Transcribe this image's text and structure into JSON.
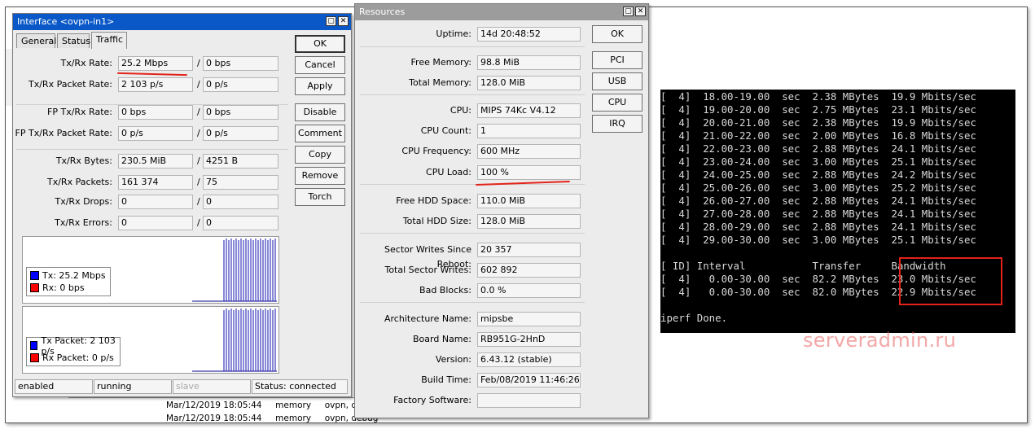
{
  "interface_window": {
    "title": "Interface <ovpn-in1>",
    "tabs": [
      "General",
      "Status",
      "Traffic"
    ],
    "active_tab": "Traffic",
    "rows": [
      {
        "label": "Tx/Rx Rate:",
        "tx": "25.2 Mbps",
        "rx": "0 bps"
      },
      {
        "label": "Tx/Rx Packet Rate:",
        "tx": "2 103 p/s",
        "rx": "0 p/s"
      },
      {
        "label": "FP Tx/Rx Rate:",
        "tx": "0 bps",
        "rx": "0 bps"
      },
      {
        "label": "FP Tx/Rx Packet Rate:",
        "tx": "0 p/s",
        "rx": "0 p/s"
      },
      {
        "label": "Tx/Rx Bytes:",
        "tx": "230.5 MiB",
        "rx": "4251 B"
      },
      {
        "label": "Tx/Rx Packets:",
        "tx": "161 374",
        "rx": "75"
      },
      {
        "label": "Tx/Rx Drops:",
        "tx": "0",
        "rx": "0"
      },
      {
        "label": "Tx/Rx Errors:",
        "tx": "0",
        "rx": "0"
      }
    ],
    "slash": "/",
    "buttons": [
      "OK",
      "Cancel",
      "Apply",
      "Disable",
      "Comment",
      "Copy",
      "Remove",
      "Torch"
    ],
    "graph1_legend": [
      {
        "text": "Tx:  25.2 Mbps",
        "color": "#0000ff"
      },
      {
        "text": "Rx:  0 bps",
        "color": "#ff0000"
      }
    ],
    "graph2_legend": [
      {
        "text": "Tx Packet:  2 103 p/s",
        "color": "#0000ff"
      },
      {
        "text": "Rx Packet:  0 p/s",
        "color": "#ff0000"
      }
    ],
    "status_bar": [
      "enabled",
      "running",
      "slave",
      "Status: connected"
    ]
  },
  "resources_window": {
    "title": "Resources",
    "rows": [
      {
        "label": "Uptime:",
        "value": "14d 20:48:52"
      },
      {
        "label": "Free Memory:",
        "value": "98.8 MiB"
      },
      {
        "label": "Total Memory:",
        "value": "128.0 MiB"
      },
      {
        "label": "CPU:",
        "value": "MIPS 74Kc V4.12"
      },
      {
        "label": "CPU Count:",
        "value": "1"
      },
      {
        "label": "CPU Frequency:",
        "value": "600 MHz"
      },
      {
        "label": "CPU Load:",
        "value": "100 %"
      },
      {
        "label": "Free HDD Space:",
        "value": "110.0 MiB"
      },
      {
        "label": "Total HDD Size:",
        "value": "128.0 MiB"
      },
      {
        "label": "Sector Writes Since Reboot:",
        "value": "20 357"
      },
      {
        "label": "Total Sector Writes:",
        "value": "602 892"
      },
      {
        "label": "Bad Blocks:",
        "value": "0.0 %"
      },
      {
        "label": "Architecture Name:",
        "value": "mipsbe"
      },
      {
        "label": "Board Name:",
        "value": "RB951G-2HnD"
      },
      {
        "label": "Version:",
        "value": "6.43.12 (stable)"
      },
      {
        "label": "Build Time:",
        "value": "Feb/08/2019 11:46:26"
      },
      {
        "label": "Factory Software:",
        "value": ""
      }
    ],
    "buttons": [
      "OK",
      "PCI",
      "USB",
      "CPU",
      "IRQ"
    ]
  },
  "log_behind": [
    {
      "time": "Mar/12/2019 18:05:44",
      "topic": "memory",
      "msg": "ovpn, debu"
    },
    {
      "time": "Mar/12/2019 18:05:44",
      "topic": "memory",
      "msg": "ovpn, debug"
    }
  ],
  "terminal": {
    "lines": [
      "[  4]  18.00-19.00  sec  2.38 MBytes  19.9 Mbits/sec",
      "[  4]  19.00-20.00  sec  2.75 MBytes  23.1 Mbits/sec",
      "[  4]  20.00-21.00  sec  2.38 MBytes  19.9 Mbits/sec",
      "[  4]  21.00-22.00  sec  2.00 MBytes  16.8 Mbits/sec",
      "[  4]  22.00-23.00  sec  2.88 MBytes  24.1 Mbits/sec",
      "[  4]  23.00-24.00  sec  3.00 MBytes  25.1 Mbits/sec",
      "[  4]  24.00-25.00  sec  2.88 MBytes  24.2 Mbits/sec",
      "[  4]  25.00-26.00  sec  3.00 MBytes  25.2 Mbits/sec",
      "[  4]  26.00-27.00  sec  2.88 MBytes  24.1 Mbits/sec",
      "[  4]  27.00-28.00  sec  2.88 MBytes  24.1 Mbits/sec",
      "[  4]  28.00-29.00  sec  2.88 MBytes  24.1 Mbits/sec",
      "[  4]  29.00-30.00  sec  3.00 MBytes  25.1 Mbits/sec",
      "",
      "[ ID] Interval           Transfer     Bandwidth",
      "[  4]   0.00-30.00  sec  82.2 MBytes  23.0 Mbits/sec",
      "[  4]   0.00-30.00  sec  82.0 MBytes  22.9 Mbits/sec",
      "",
      "iperf Done."
    ]
  },
  "watermark": "serveradmin.ru",
  "colors": {
    "highlight": "#e2231a",
    "tx": "#0000ff",
    "rx": "#ff0000"
  }
}
